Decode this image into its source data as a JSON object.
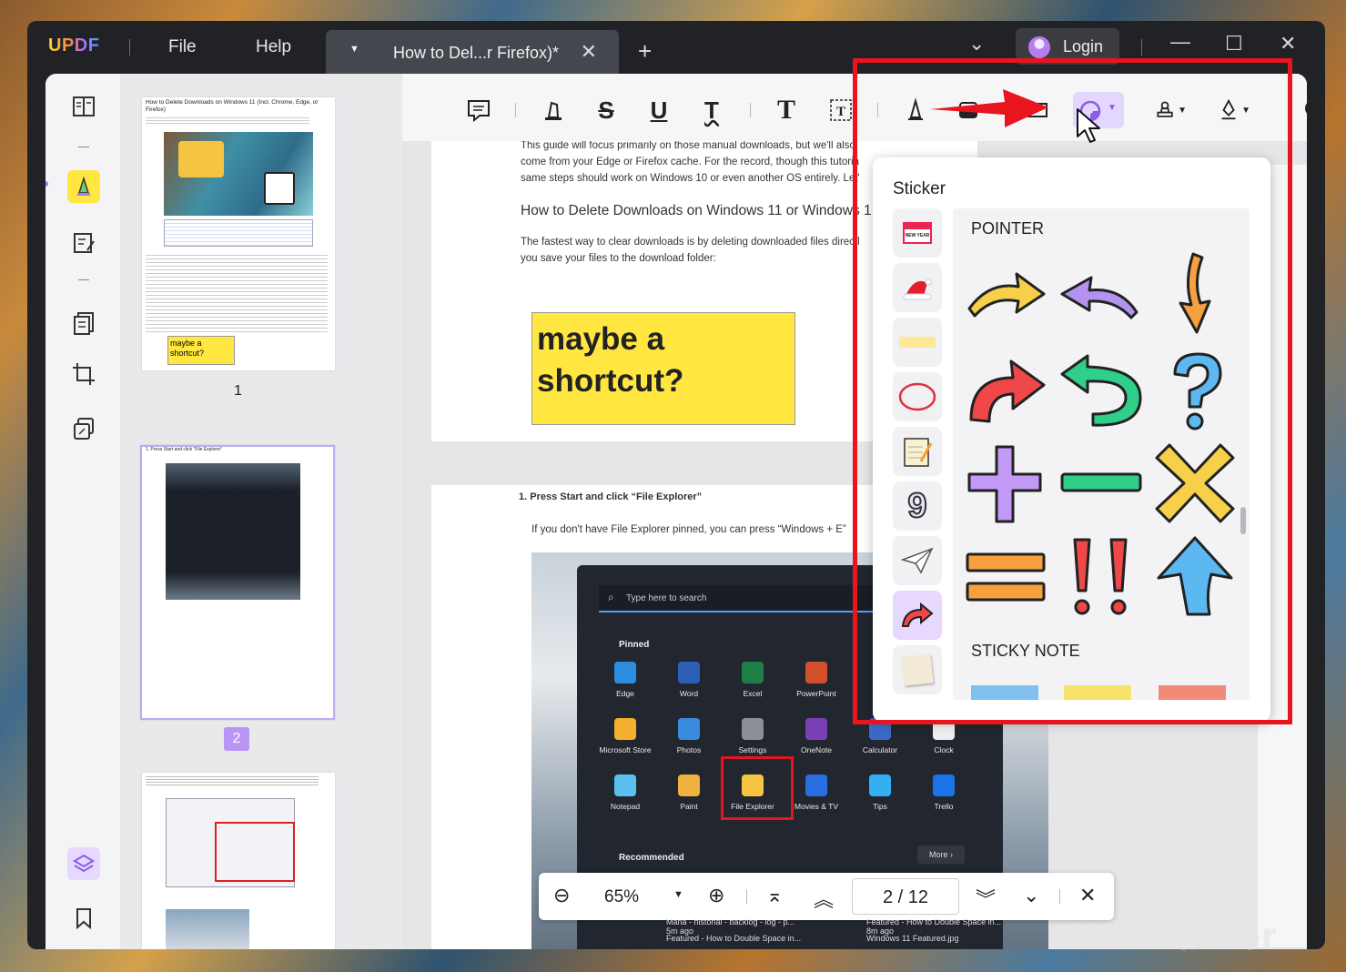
{
  "titlebar": {
    "logo": "UPDF",
    "menu_file": "File",
    "menu_help": "Help",
    "tab_title": "How to Del...r Firefox)*",
    "login": "Login"
  },
  "thumbnails": {
    "page1": {
      "number": "1",
      "title": "How to Delete Downloads on Windows 11 (Incl. Chrome, Edge, or Firefox)",
      "note": "maybe a shortcut?"
    },
    "page2": {
      "number": "2",
      "title": "1. Press Start and click \"File Explorer\""
    }
  },
  "document": {
    "intro_line1": "This guide will focus primarily on those manual downloads, but we'll also",
    "intro_line2": "come from your Edge or Firefox cache. For the record, though this tutoria",
    "intro_line3": "same steps should work on Windows 10 or even another OS entirely. Let'",
    "heading": "How to Delete Downloads on Windows 11 or Windows 1",
    "para_line1": "The fastest way to clear downloads is by deleting downloaded files directl",
    "para_line2": "you save your files to the download folder:",
    "sticky_note": "maybe a shortcut?",
    "step_heading": "1. Press Start and click “File Explorer”",
    "step_text": "If you don't have File Explorer pinned, you can press “Windows + E”",
    "start_menu": {
      "search_placeholder": "Type here to search",
      "pinned_label": "Pinned",
      "apps": [
        "Edge",
        "Word",
        "Excel",
        "PowerPoint",
        "",
        "",
        "Microsoft Store",
        "Photos",
        "Settings",
        "OneNote",
        "Calculator",
        "Clock",
        "Notepad",
        "Paint",
        "File Explorer",
        "Movies & TV",
        "Tips",
        "Trello"
      ],
      "recommended_label": "Recommended",
      "more_label": "More",
      "rec_items": [
        {
          "name": "Mana - historial - backlog - log - p...",
          "time": "5m ago"
        },
        {
          "name": "Featured - How to Double Space in...",
          "time": "8m ago"
        },
        {
          "name": "Featured - How to Double Space in...",
          "time": ""
        },
        {
          "name": "Windows 11 Featured.jpg",
          "time": ""
        }
      ]
    }
  },
  "sticker_panel": {
    "title": "Sticker",
    "section_pointer": "POINTER",
    "section_sticky": "STICKY NOTE",
    "category_year_label": "NEW YEAR"
  },
  "zoombar": {
    "zoom": "65%",
    "current_page": "2",
    "page_sep": "/",
    "total_pages": "12"
  },
  "watermark": "WinBuzzer",
  "colors": {
    "accent": "#a67cf5",
    "highlight_yellow": "#ffe640",
    "annotation_red": "#e8141e"
  }
}
